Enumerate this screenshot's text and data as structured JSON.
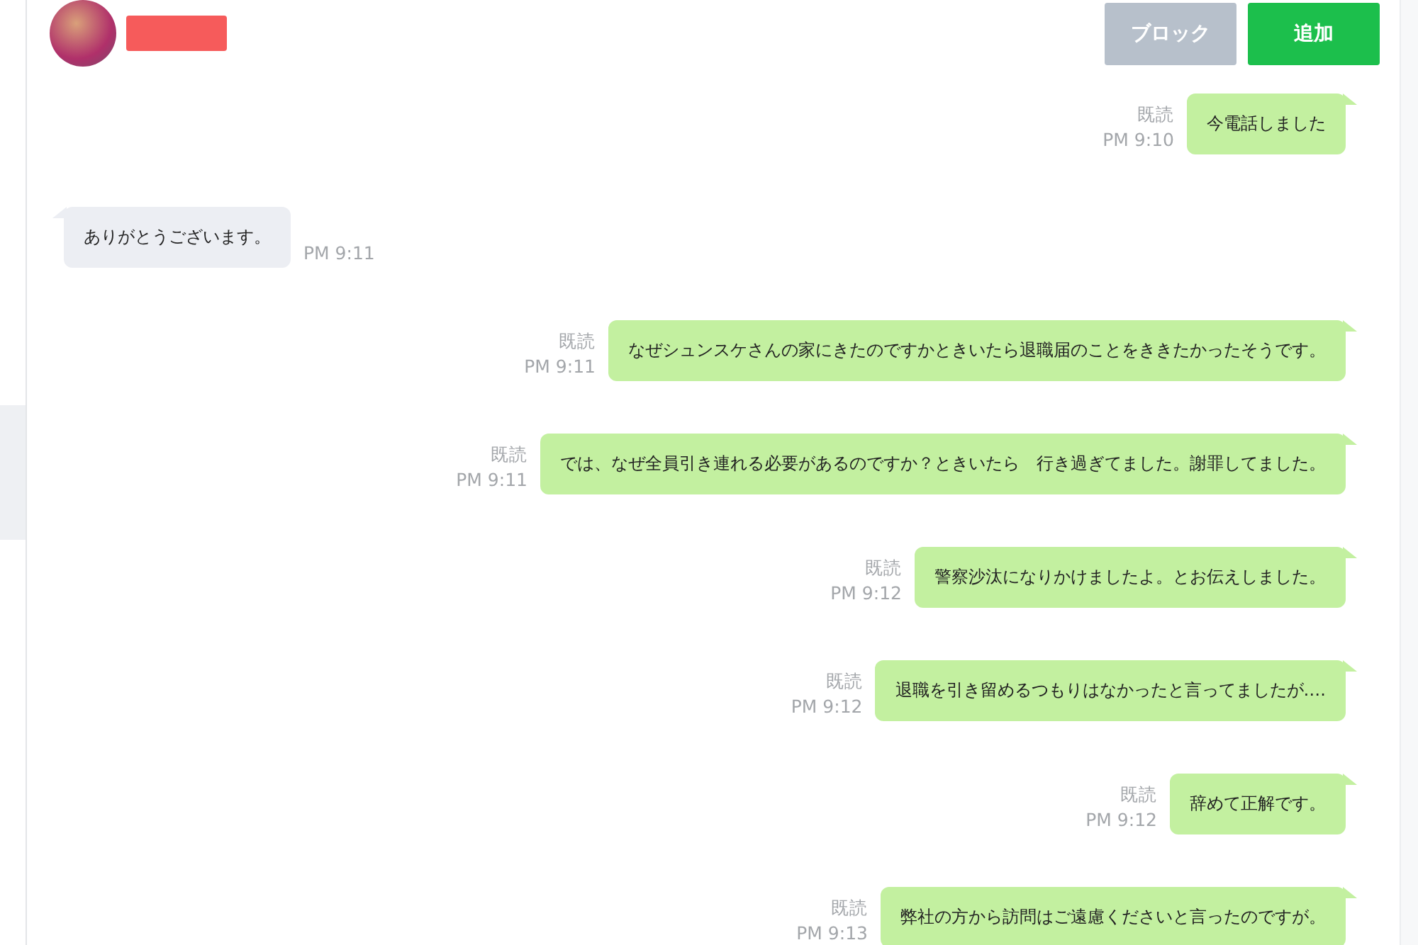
{
  "header": {
    "buttons": [
      {
        "label": "ブロック",
        "kind": "secondary"
      },
      {
        "label": "追加",
        "kind": "primary"
      }
    ]
  },
  "messages": [
    {
      "kind": "sent",
      "text": "今電話しました",
      "read_label": "既読",
      "time": "PM 9:10"
    },
    {
      "kind": "received",
      "text": "ありがとうございます。",
      "time": "PM 9:11"
    },
    {
      "kind": "sent",
      "text": "なぜシュンスケさんの家にきたのですかときいたら退職届のことをききたかったそうです。",
      "read_label": "既読",
      "time": "PM 9:11"
    },
    {
      "kind": "sent",
      "text": "では、なぜ全員引き連れる必要があるのですか？ときいたら　行き過ぎてました。謝罪してました。",
      "read_label": "既読",
      "time": "PM 9:11"
    },
    {
      "kind": "sent",
      "text": "警察沙汰になりかけましたよ。とお伝えしました。",
      "read_label": "既読",
      "time": "PM 9:12"
    },
    {
      "kind": "sent",
      "text": "退職を引き留めるつもりはなかったと言ってましたが‥‥",
      "read_label": "既読",
      "time": "PM 9:12"
    },
    {
      "kind": "sent",
      "text": "辞めて正解です。",
      "read_label": "既読",
      "time": "PM 9:12"
    },
    {
      "kind": "sent",
      "text": "弊社の方から訪問はご遠慮くださいと言ったのですが。",
      "read_label": "既読",
      "time": "PM 9:13"
    }
  ]
}
